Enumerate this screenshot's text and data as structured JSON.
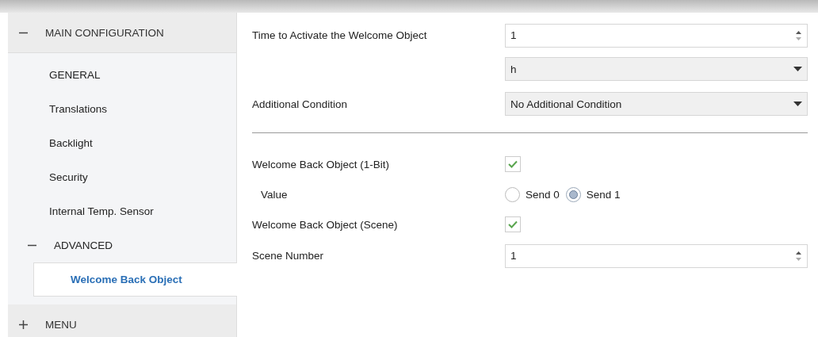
{
  "sidebar": {
    "sections": [
      {
        "label": "MAIN CONFIGURATION",
        "expanded": true,
        "children": [
          {
            "label": "GENERAL",
            "selected": false
          },
          {
            "label": "Translations",
            "selected": false
          },
          {
            "label": "Backlight",
            "selected": false
          },
          {
            "label": "Security",
            "selected": false
          },
          {
            "label": "Internal Temp. Sensor",
            "selected": false
          },
          {
            "label": "ADVANCED",
            "expanded": true,
            "selected": false,
            "children": [
              {
                "label": "Welcome Back Object",
                "selected": true
              }
            ]
          }
        ]
      },
      {
        "label": "MENU",
        "expanded": false
      }
    ]
  },
  "parameters": [
    {
      "kind": "spinner",
      "label": "Time to Activate the Welcome Object",
      "value": "1"
    },
    {
      "kind": "dropdown",
      "value": "h"
    },
    {
      "kind": "dropdown",
      "label": "Additional Condition",
      "value": "No Additional Condition"
    },
    {
      "kind": "divider"
    },
    {
      "kind": "checkbox",
      "label": "Welcome Back Object (1-Bit)",
      "checked": true,
      "children": [
        {
          "kind": "radio",
          "label": "Value",
          "options": [
            {
              "label": "Send 0",
              "selected": false
            },
            {
              "label": "Send 1",
              "selected": true
            }
          ]
        }
      ]
    },
    {
      "kind": "checkbox",
      "label": "Welcome Back Object (Scene)",
      "checked": true
    },
    {
      "kind": "spinner",
      "label": "Scene Number",
      "value": "1"
    }
  ]
}
